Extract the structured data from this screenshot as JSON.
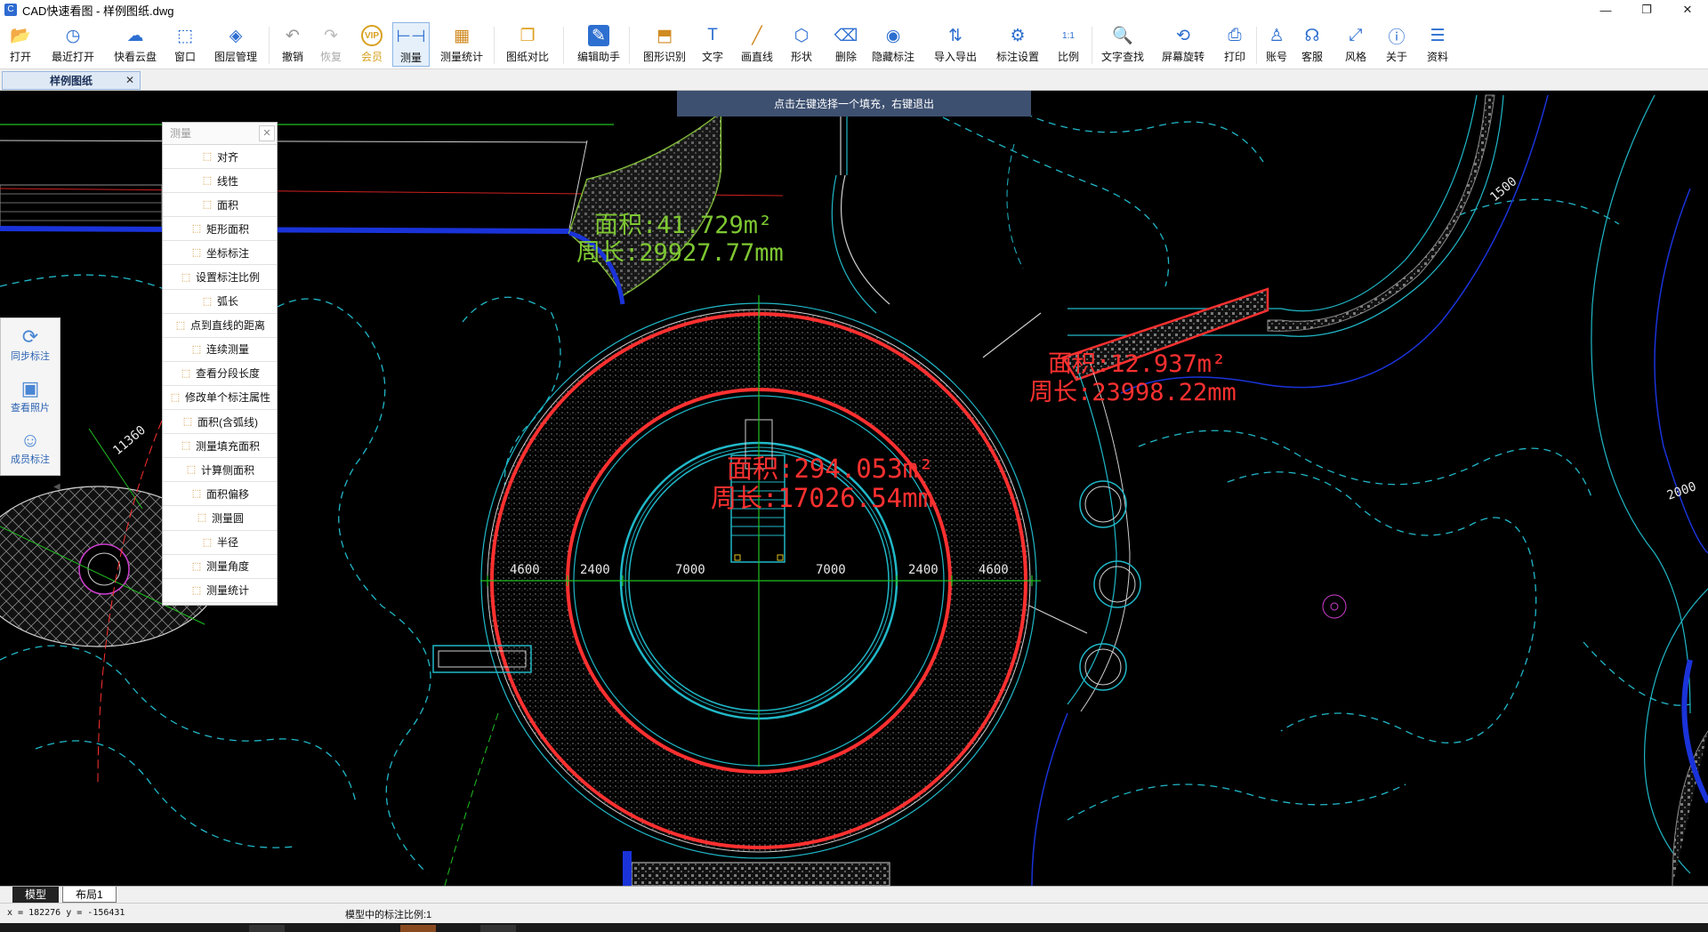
{
  "window": {
    "title": "CAD快速看图 - 样例图纸.dwg",
    "controls": [
      "—",
      "❐",
      "✕"
    ]
  },
  "toolbar": {
    "items": [
      {
        "label": "打开",
        "icon": "folder-open-icon"
      },
      {
        "label": "最近打开",
        "icon": "clock-history-icon"
      },
      {
        "label": "快看云盘",
        "icon": "cloud-icon"
      },
      {
        "label": "窗口",
        "icon": "window-frame-icon"
      },
      {
        "label": "图层管理",
        "icon": "layers-icon"
      },
      {
        "label": "撤销",
        "icon": "undo-icon"
      },
      {
        "label": "恢复",
        "icon": "redo-icon"
      },
      {
        "label": "会员",
        "icon": "vip-icon",
        "badge": "VIP"
      },
      {
        "label": "测量",
        "icon": "ruler-icon"
      },
      {
        "label": "测量统计",
        "icon": "measure-stats-icon"
      },
      {
        "label": "图纸对比",
        "icon": "compare-icon"
      },
      {
        "label": "编辑助手",
        "icon": "edit-assistant-icon"
      },
      {
        "label": "图形识别",
        "icon": "shape-recognize-icon"
      },
      {
        "label": "文字",
        "icon": "text-icon"
      },
      {
        "label": "画直线",
        "icon": "line-icon"
      },
      {
        "label": "形状",
        "icon": "shape-icon"
      },
      {
        "label": "删除",
        "icon": "eraser-icon"
      },
      {
        "label": "隐藏标注",
        "icon": "eye-icon"
      },
      {
        "label": "导入导出",
        "icon": "import-export-icon"
      },
      {
        "label": "标注设置",
        "icon": "annotation-settings-icon"
      },
      {
        "label": "比例",
        "icon": "scale-icon"
      },
      {
        "label": "文字查找",
        "icon": "text-search-icon"
      },
      {
        "label": "屏幕旋转",
        "icon": "rotate-screen-icon"
      },
      {
        "label": "打印",
        "icon": "printer-icon"
      },
      {
        "label": "账号",
        "icon": "user-icon"
      },
      {
        "label": "客服",
        "icon": "headset-icon"
      },
      {
        "label": "风格",
        "icon": "style-icon"
      },
      {
        "label": "关于",
        "icon": "info-icon"
      },
      {
        "label": "资料",
        "icon": "docs-icon"
      }
    ]
  },
  "tabs": {
    "document": "样例图纸",
    "close": "✕"
  },
  "canvas": {
    "hint": "点击左键选择一个填充，右键退出",
    "annotations": {
      "green_area": "面积:41.729m²",
      "green_perimeter": "周长:29927.77mm",
      "right_area": "面积:12.937m²",
      "right_perimeter": "周长:23998.22mm",
      "center_area": "面积:294.053m²",
      "center_perimeter": "周长:17026.54mm"
    },
    "dimensions": [
      "4600",
      "2400",
      "7000",
      "7000",
      "2400",
      "4600"
    ],
    "side_dims": [
      "11360",
      "1500",
      "2000"
    ]
  },
  "measure_panel": {
    "title": "测量",
    "close": "✕",
    "items": [
      {
        "label": "对齐",
        "icon": "align-icon"
      },
      {
        "label": "线性",
        "icon": "linear-icon"
      },
      {
        "label": "面积",
        "icon": "area-icon"
      },
      {
        "label": "矩形面积",
        "icon": "rect-area-icon"
      },
      {
        "label": "坐标标注",
        "icon": "coordinate-icon"
      },
      {
        "label": "设置标注比例",
        "icon": "scale-setting-icon"
      },
      {
        "label": "弧长",
        "icon": "arc-length-icon"
      },
      {
        "label": "点到直线的距离",
        "icon": "point-line-icon"
      },
      {
        "label": "连续测量",
        "icon": "continuous-icon"
      },
      {
        "label": "查看分段长度",
        "icon": "segment-icon"
      },
      {
        "label": "修改单个标注属性",
        "icon": "edit-annotation-icon"
      },
      {
        "label": "面积(含弧线)",
        "icon": "arc-area-icon"
      },
      {
        "label": "测量填充面积",
        "icon": "fill-area-icon"
      },
      {
        "label": "计算侧面积",
        "icon": "side-area-icon"
      },
      {
        "label": "面积偏移",
        "icon": "area-offset-icon"
      },
      {
        "label": "测量圆",
        "icon": "circle-icon"
      },
      {
        "label": "半径",
        "icon": "radius-icon"
      },
      {
        "label": "测量角度",
        "icon": "angle-icon"
      },
      {
        "label": "测量统计",
        "icon": "stats-icon"
      }
    ]
  },
  "side_panel": {
    "items": [
      {
        "label": "同步标注",
        "icon": "sync-icon"
      },
      {
        "label": "查看照片",
        "icon": "photo-icon"
      },
      {
        "label": "成员标注",
        "icon": "members-icon"
      }
    ],
    "collapse": "◀"
  },
  "layout_tabs": [
    "模型",
    "布局1"
  ],
  "status": {
    "coords": "x = 182276  y = -156431",
    "scale": "模型中的标注比例:1"
  },
  "colors": {
    "accent": "#2e6bd1",
    "cyan": "#20c8c8",
    "red": "#ff3030",
    "green_annot": "#7ec832",
    "hint_bg": "#3e5070"
  }
}
